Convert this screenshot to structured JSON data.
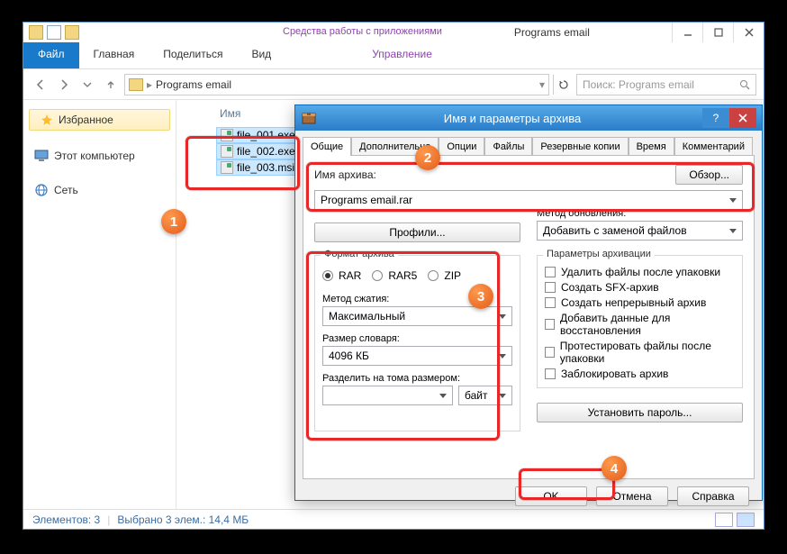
{
  "explorer": {
    "window_title": "Programs email",
    "tools_label": "Средства работы с приложениями",
    "ribbon": {
      "file": "Файл",
      "home": "Главная",
      "share": "Поделиться",
      "view": "Вид",
      "manage": "Управление"
    },
    "nav": {
      "address": "Programs email",
      "search_placeholder": "Поиск: Programs email"
    },
    "sidebar": {
      "favorites": "Избранное",
      "this_pc": "Этот компьютер",
      "network": "Сеть"
    },
    "filepane": {
      "col_name": "Имя",
      "files": [
        {
          "name": "file_001.exe"
        },
        {
          "name": "file_002.exe"
        },
        {
          "name": "file_003.msi"
        }
      ]
    },
    "statusbar": {
      "items": "Элементов: 3",
      "selected": "Выбрано 3 элем.: 14,4 МБ"
    }
  },
  "dialog": {
    "title": "Имя и параметры архива",
    "tabs": {
      "general": "Общие",
      "advanced": "Дополнительно",
      "options": "Опции",
      "files": "Файлы",
      "backup": "Резервные копии",
      "time": "Время",
      "comment": "Комментарий"
    },
    "archive_name_label": "Имя архива:",
    "browse_btn": "Обзор...",
    "archive_name": "Programs email.rar",
    "profiles_btn": "Профили...",
    "update_mode_label": "Метод обновления:",
    "update_mode": "Добавить с заменой файлов",
    "format_group": "Формат архива",
    "format_rar": "RAR",
    "format_rar5": "RAR5",
    "format_zip": "ZIP",
    "compression_label": "Метод сжатия:",
    "compression": "Максимальный",
    "dict_label": "Размер словаря:",
    "dict": "4096 КБ",
    "split_label": "Разделить на тома размером:",
    "split_value": "",
    "split_unit": "байт",
    "params_group": "Параметры архивации",
    "opt_delete": "Удалить файлы после упаковки",
    "opt_sfx": "Создать SFX-архив",
    "opt_solid": "Создать непрерывный архив",
    "opt_recovery": "Добавить данные для восстановления",
    "opt_test": "Протестировать файлы после упаковки",
    "opt_lock": "Заблокировать архив",
    "password_btn": "Установить пароль...",
    "ok_btn": "OK",
    "cancel_btn": "Отмена",
    "help_btn": "Справка"
  },
  "markers": {
    "m1": "1",
    "m2": "2",
    "m3": "3",
    "m4": "4"
  }
}
